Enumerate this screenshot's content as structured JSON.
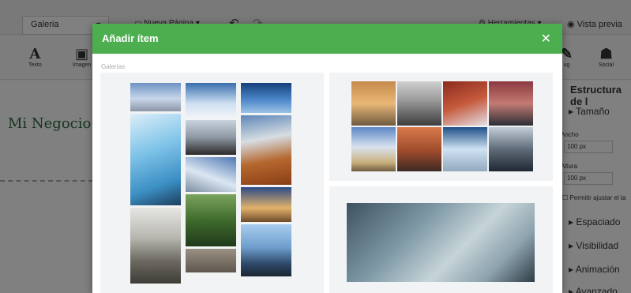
{
  "editor": {
    "page_select": "Galeria",
    "new_page": "Nueva Página",
    "tools": "Herramientas",
    "preview": "Vista previa",
    "toolbar": [
      {
        "icon": "A",
        "label": "Texto"
      },
      {
        "icon": "▣",
        "label": "Imagen"
      }
    ],
    "toolbar_right": [
      {
        "icon": "✎",
        "label": "ug"
      },
      {
        "icon": "☗",
        "label": "Social"
      }
    ],
    "business_name": "Mi Negocio",
    "panel": {
      "title": "Estructura de l",
      "size": "Tamaño",
      "width_label": "Ancho",
      "width_value": "100",
      "width_unit": "px",
      "height_label": "Altura",
      "height_value": "100",
      "height_unit": "px",
      "adjust": "Permitir ajustar el ta",
      "spacing": "Espaciado",
      "visibility": "Visibilidad",
      "animation": "Animación",
      "advanced": "Avanzado"
    }
  },
  "modal": {
    "title": "Añadir ítem",
    "section_label": "Galerías",
    "close_icon": "close-icon"
  },
  "colors": {
    "header_green": "#4cae4f",
    "business_green": "#2a6b3c"
  }
}
